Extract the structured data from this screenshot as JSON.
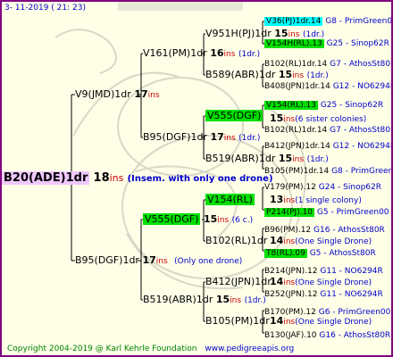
{
  "header": {
    "date": "3-  11-2019 (  21:  23)"
  },
  "footer": {
    "copyright": "Copyright 2004-2019 @ Karl Kehrle Foundation",
    "site": "www.pedigreeapis.org"
  },
  "colors": {
    "border": "#800080",
    "line": "#000000",
    "ins": "#cc0000",
    "code": "#0000cc",
    "cyan": "#00ffff",
    "green": "#00e000",
    "root_bg": "#f0c8ff"
  },
  "root": {
    "name": "B20(ADE)1dr",
    "num": "18",
    "ins": "ins",
    "note": "(Insem. with only one drone)"
  },
  "gen1": [
    {
      "name": "V9(JMD)1dr",
      "num": "17",
      "ins": "ins"
    },
    {
      "name": "B95(DGF)1dr",
      "num": "17",
      "ins": "ins",
      "note": "(Only one drone)"
    }
  ],
  "gen2": [
    {
      "name": "V161(PM)1dr",
      "num": "16",
      "ins": "ins",
      "note": "(1dr.)"
    },
    {
      "name": "B95(DGF)1dr",
      "num": "17",
      "ins": "ins",
      "note": "(1dr.)"
    },
    {
      "name": "V555(DGF)",
      "num": "15",
      "ins": "ins",
      "note": "(6 c.)"
    },
    {
      "name": "B519(ABR)1dr",
      "num": "15",
      "ins": "ins",
      "note": "(1dr.)"
    }
  ],
  "gen3": [
    {
      "name": "V951H(PJ)1dr",
      "num": "15",
      "ins": "ins",
      "note": "(1dr.)"
    },
    {
      "name": "B589(ABR)1dr",
      "num": "15",
      "ins": "ins",
      "note": "(1dr.)"
    },
    {
      "name": "V555(DGF)",
      "num": "15",
      "ins": "ins",
      "note": "(6 sister colonies)"
    },
    {
      "name": "B519(ABR)1dr",
      "num": "15",
      "ins": "ins",
      "note": "(1dr.)"
    },
    {
      "name": "V154(RL)",
      "num": "13",
      "ins": "ins",
      "note": "(1 single colony)"
    },
    {
      "name": "B102(RL)1dr",
      "num": "14",
      "ins": "ins",
      "note": "(One Single Drone)"
    },
    {
      "name": "B412(JPN)1dr",
      "num": "14",
      "ins": "ins",
      "note": "(One Single Drone)"
    },
    {
      "name": "B105(PM)1dr",
      "num": "14",
      "ins": "ins",
      "note": "(One Single Drone)"
    }
  ],
  "gen4": [
    {
      "name": "V36(PJ)1dr.14",
      "code": "G8 - PrimGreen00"
    },
    {
      "name": "V154H(RL).13",
      "code": "G25 - Sinop62R"
    },
    {
      "name": "B102(RL)1dr.14",
      "code": "G7 - AthosSt80R"
    },
    {
      "name": "B408(JPN)1dr.14",
      "code": "G12 - NO6294R"
    },
    {
      "name": "V154(RL).13",
      "code": "G25 - Sinop62R"
    },
    {
      "name": "B102(RL)1dr.14",
      "code": "G7 - AthosSt80R"
    },
    {
      "name": "B412(JPN)1dr.14",
      "code": "G12 - NO6294R"
    },
    {
      "name": "B105(PM)1dr.14",
      "code": "G8 - PrimGreen00"
    },
    {
      "name": "V179(PM).12",
      "code": "G24 - Sinop62R"
    },
    {
      "name": "P214(PJ).10",
      "code": "G5 - PrimGreen00"
    },
    {
      "name": "B96(PM).12",
      "code": "G16 - AthosSt80R"
    },
    {
      "name": "T8(RL).09",
      "code": "G5 - AthosSt80R"
    },
    {
      "name": "B214(JPN).12",
      "code": "G11 - NO6294R"
    },
    {
      "name": "B252(JPN).12",
      "code": "G11 - NO6294R"
    },
    {
      "name": "B170(PM).12",
      "code": "G6 - PrimGreen00"
    },
    {
      "name": "B130(JAF).10",
      "code": "G16 - AthosSt80R"
    }
  ]
}
